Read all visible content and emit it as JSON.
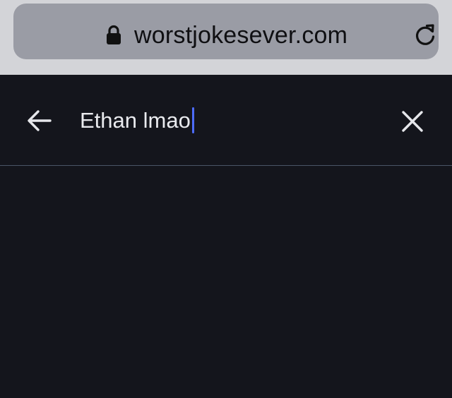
{
  "browser": {
    "url": "worstjokesever.com",
    "lock_icon": "lock-icon",
    "reload_icon": "reload-icon"
  },
  "search": {
    "back_icon": "arrow-left-icon",
    "query": "Ethan lmao",
    "clear_icon": "close-icon"
  },
  "colors": {
    "page_background": "#14151c",
    "browser_chrome": "#d3d4d8",
    "url_pill": "#9a9ca5",
    "caret": "#4d6cff",
    "divider": "#4a5566",
    "text": "#e9eaee"
  }
}
